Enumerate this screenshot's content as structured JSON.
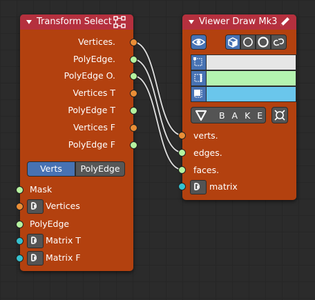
{
  "transform_select": {
    "title": "Transform Select",
    "outputs": [
      {
        "label": "Vertices.",
        "socket": "orange"
      },
      {
        "label": "PolyEdge.",
        "socket": "green"
      },
      {
        "label": "PolyEdge O.",
        "socket": "green"
      },
      {
        "label": "Vertices T",
        "socket": "orange"
      },
      {
        "label": "PolyEdge T",
        "socket": "green"
      },
      {
        "label": "Vertices F",
        "socket": "orange"
      },
      {
        "label": "PolyEdge F",
        "socket": "green"
      }
    ],
    "mode_options": [
      "Verts",
      "PolyEdge"
    ],
    "mode_selected": "Verts",
    "inputs": [
      {
        "label": "Mask",
        "socket": "green"
      },
      {
        "label": "Vertices",
        "socket": "orange"
      },
      {
        "label": "PolyEdge",
        "socket": "green"
      },
      {
        "label": "Matrix T",
        "socket": "cyan"
      },
      {
        "label": "Matrix F",
        "socket": "cyan"
      }
    ]
  },
  "viewer_draw": {
    "title": "Viewer Draw Mk3",
    "bake_label": "B A K E",
    "colors": {
      "vertex": "#e6e6e6",
      "edge": "#b4f4b0",
      "face": "#6ac6ec"
    },
    "inputs": [
      {
        "label": "verts.",
        "socket": "orange"
      },
      {
        "label": "edges.",
        "socket": "green"
      },
      {
        "label": "faces.",
        "socket": "green"
      },
      {
        "label": "matrix",
        "socket": "cyan"
      }
    ]
  },
  "palette": {
    "node_body": "#b3410f",
    "node_header": "#b5303e",
    "socket_orange": "#ea8e36",
    "socket_green": "#b5f3a0",
    "socket_cyan": "#36c1cf",
    "active_blue": "#4772b3"
  },
  "icons": [
    "node-tree-icon",
    "pencil-icon",
    "eye-icon",
    "cube-icon",
    "circle-outline-icon",
    "circle-icon",
    "link-icon",
    "bake-triangle-icon",
    "center-icon",
    "matrix-icon",
    "collapse-arrow-icon"
  ]
}
